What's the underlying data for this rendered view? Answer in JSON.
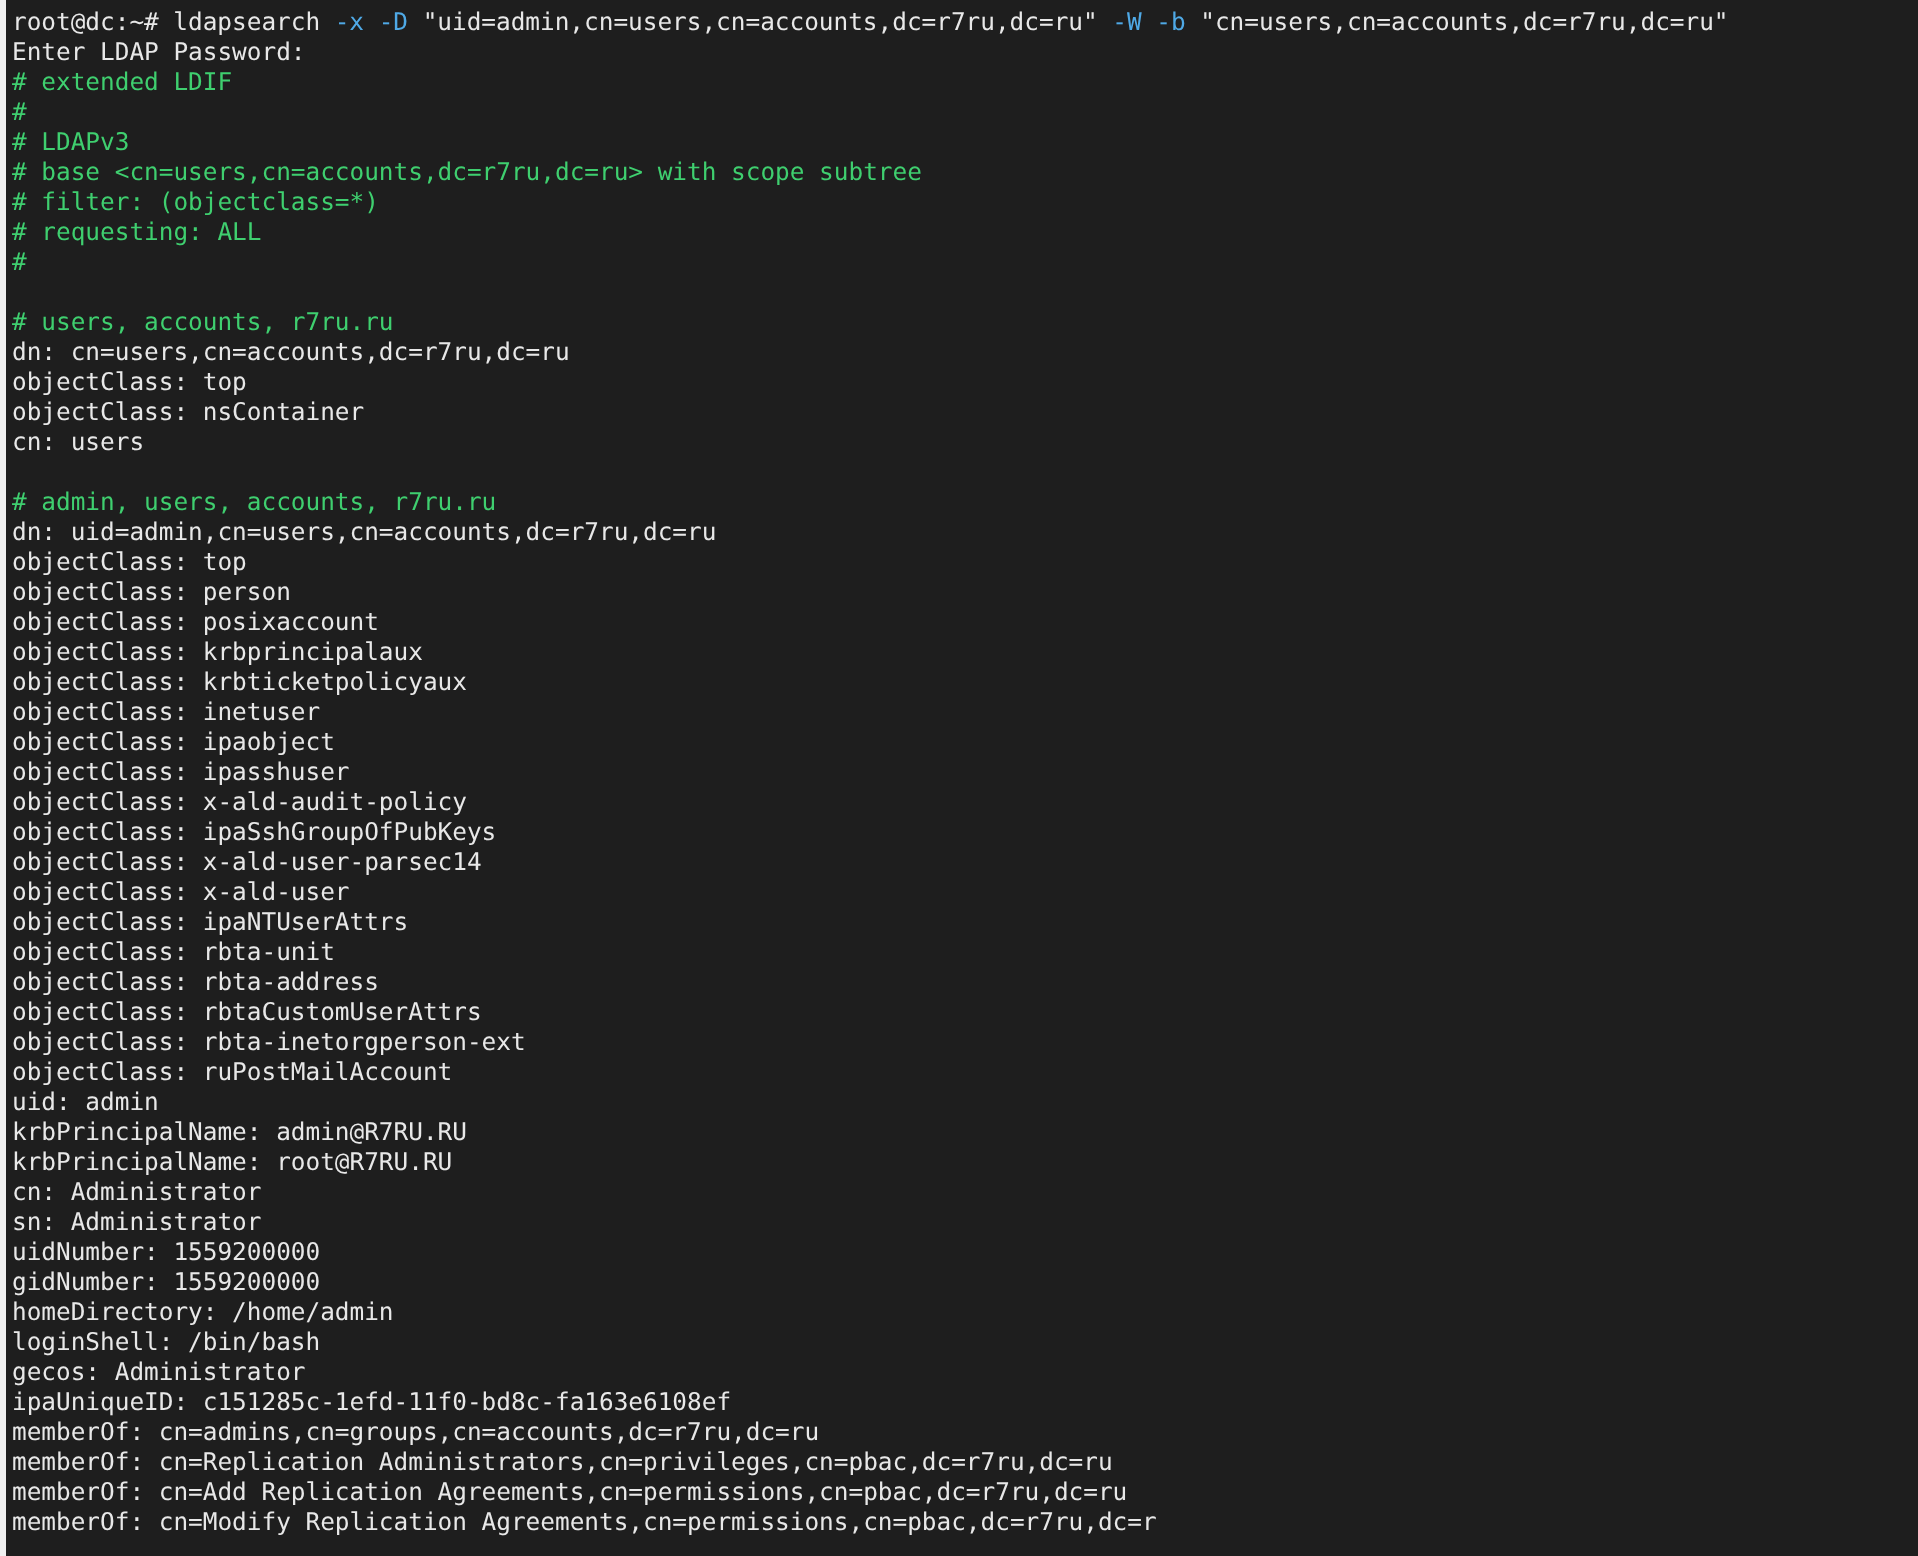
{
  "terminal": {
    "command": {
      "prompt": "root@dc:~#",
      "parts": [
        {
          "kind": "arg",
          "text": "ldapsearch"
        },
        {
          "kind": "flag",
          "text": "-x"
        },
        {
          "kind": "flag",
          "text": "-D"
        },
        {
          "kind": "arg",
          "text": "\"uid=admin,cn=users,cn=accounts,dc=r7ru,dc=ru\""
        },
        {
          "kind": "flag",
          "text": "-W"
        },
        {
          "kind": "flag",
          "text": "-b"
        },
        {
          "kind": "arg",
          "text": "\"cn=users,cn=accounts,dc=r7ru,dc=ru\""
        }
      ]
    },
    "lines": [
      {
        "kind": "output",
        "text": "Enter LDAP Password:"
      },
      {
        "kind": "comment",
        "text": "# extended LDIF"
      },
      {
        "kind": "comment",
        "text": "#"
      },
      {
        "kind": "comment",
        "text": "# LDAPv3"
      },
      {
        "kind": "comment",
        "text": "# base <cn=users,cn=accounts,dc=r7ru,dc=ru> with scope subtree"
      },
      {
        "kind": "comment",
        "text": "# filter: (objectclass=*)"
      },
      {
        "kind": "comment",
        "text": "# requesting: ALL"
      },
      {
        "kind": "comment",
        "text": "#"
      },
      {
        "kind": "blank"
      },
      {
        "kind": "comment",
        "text": "# users, accounts, r7ru.ru"
      },
      {
        "kind": "output",
        "text": "dn: cn=users,cn=accounts,dc=r7ru,dc=ru"
      },
      {
        "kind": "output",
        "text": "objectClass: top"
      },
      {
        "kind": "output",
        "text": "objectClass: nsContainer"
      },
      {
        "kind": "output",
        "text": "cn: users"
      },
      {
        "kind": "blank"
      },
      {
        "kind": "comment",
        "text": "# admin, users, accounts, r7ru.ru"
      },
      {
        "kind": "output",
        "text": "dn: uid=admin,cn=users,cn=accounts,dc=r7ru,dc=ru"
      },
      {
        "kind": "output",
        "text": "objectClass: top"
      },
      {
        "kind": "output",
        "text": "objectClass: person"
      },
      {
        "kind": "output",
        "text": "objectClass: posixaccount"
      },
      {
        "kind": "output",
        "text": "objectClass: krbprincipalaux"
      },
      {
        "kind": "output",
        "text": "objectClass: krbticketpolicyaux"
      },
      {
        "kind": "output",
        "text": "objectClass: inetuser"
      },
      {
        "kind": "output",
        "text": "objectClass: ipaobject"
      },
      {
        "kind": "output",
        "text": "objectClass: ipasshuser"
      },
      {
        "kind": "output",
        "text": "objectClass: x-ald-audit-policy"
      },
      {
        "kind": "output",
        "text": "objectClass: ipaSshGroupOfPubKeys"
      },
      {
        "kind": "output",
        "text": "objectClass: x-ald-user-parsec14"
      },
      {
        "kind": "output",
        "text": "objectClass: x-ald-user"
      },
      {
        "kind": "output",
        "text": "objectClass: ipaNTUserAttrs"
      },
      {
        "kind": "output",
        "text": "objectClass: rbta-unit"
      },
      {
        "kind": "output",
        "text": "objectClass: rbta-address"
      },
      {
        "kind": "output",
        "text": "objectClass: rbtaCustomUserAttrs"
      },
      {
        "kind": "output",
        "text": "objectClass: rbta-inetorgperson-ext"
      },
      {
        "kind": "output",
        "text": "objectClass: ruPostMailAccount"
      },
      {
        "kind": "output",
        "text": "uid: admin"
      },
      {
        "kind": "output",
        "text": "krbPrincipalName: admin@R7RU.RU"
      },
      {
        "kind": "output",
        "text": "krbPrincipalName: root@R7RU.RU"
      },
      {
        "kind": "output",
        "text": "cn: Administrator"
      },
      {
        "kind": "output",
        "text": "sn: Administrator"
      },
      {
        "kind": "output",
        "text": "uidNumber: 1559200000"
      },
      {
        "kind": "output",
        "text": "gidNumber: 1559200000"
      },
      {
        "kind": "output",
        "text": "homeDirectory: /home/admin"
      },
      {
        "kind": "output",
        "text": "loginShell: /bin/bash"
      },
      {
        "kind": "output",
        "text": "gecos: Administrator"
      },
      {
        "kind": "output",
        "text": "ipaUniqueID: c151285c-1efd-11f0-bd8c-fa163e6108ef"
      },
      {
        "kind": "output",
        "text": "memberOf: cn=admins,cn=groups,cn=accounts,dc=r7ru,dc=ru"
      },
      {
        "kind": "output",
        "text": "memberOf: cn=Replication Administrators,cn=privileges,cn=pbac,dc=r7ru,dc=ru"
      },
      {
        "kind": "output",
        "text": "memberOf: cn=Add Replication Agreements,cn=permissions,cn=pbac,dc=r7ru,dc=ru"
      },
      {
        "kind": "output",
        "text": "memberOf: cn=Modify Replication Agreements,cn=permissions,cn=pbac,dc=r7ru,dc=r"
      }
    ]
  }
}
